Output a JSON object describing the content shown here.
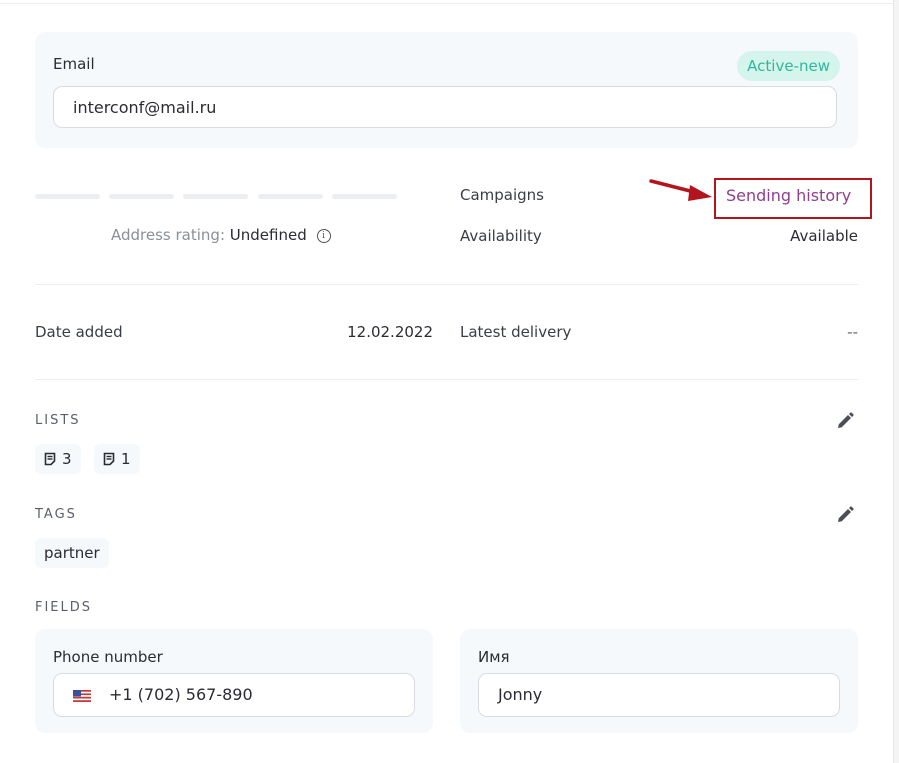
{
  "email": {
    "label": "Email",
    "value": "interconf@mail.ru",
    "status": "Active-new"
  },
  "rating": {
    "label": "Address rating:",
    "value": "Undefined",
    "info_icon": "info-icon"
  },
  "campaigns": {
    "label": "Campaigns",
    "link": "Sending history"
  },
  "availability": {
    "label": "Availability",
    "value": "Available"
  },
  "date_added": {
    "label": "Date added",
    "value": "12.02.2022"
  },
  "latest_delivery": {
    "label": "Latest delivery",
    "value": "--"
  },
  "lists": {
    "title": "LISTS",
    "items": [
      {
        "icon": "list-icon",
        "count": "3"
      },
      {
        "icon": "list-icon",
        "count": "1"
      }
    ]
  },
  "tags": {
    "title": "TAGS",
    "items": [
      "partner"
    ]
  },
  "fields": {
    "title": "FIELDS",
    "phone": {
      "label": "Phone number",
      "value": "+1 (702) 567-890",
      "flag": "us-flag-icon"
    },
    "name": {
      "label": "Имя",
      "value": "Jonny"
    }
  },
  "colors": {
    "status_bg": "#d4f4ec",
    "status_text": "#2fb89a",
    "link": "#8e3f8d",
    "highlight": "#b4151d",
    "card_bg": "#f6f9fc"
  }
}
